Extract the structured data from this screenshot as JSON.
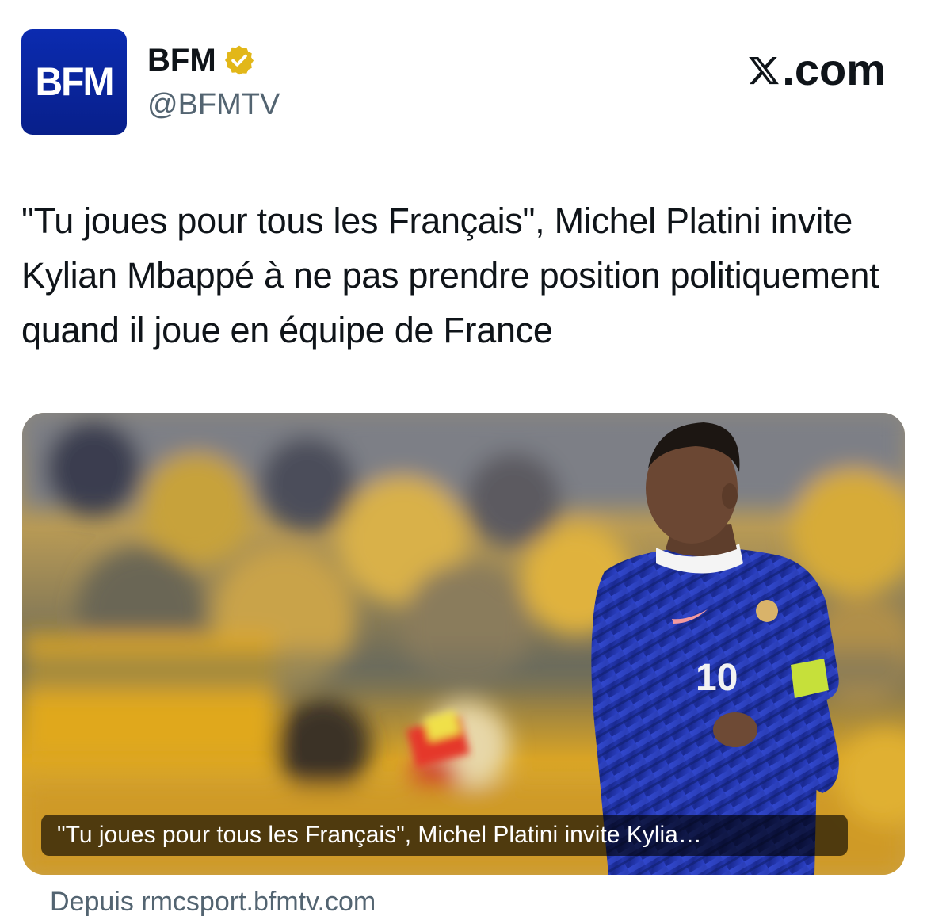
{
  "header": {
    "avatar_text": "BFM",
    "display_name": "BFM",
    "handle": "@BFMTV",
    "brand_text": ".com",
    "brand_icon": "x-logo-icon",
    "verified_icon": "verified-badge-icon",
    "verified_color": "#e2b719"
  },
  "post": {
    "headline": "\"Tu joues pour tous les Français\", Michel Platini invite Kylian Mbappé à ne pas prendre position politiquement quand il joue en équipe de France"
  },
  "card": {
    "image_icon": "article-photo",
    "caption": "\"Tu joues pour tous les Français\", Michel Platini invite Kylia…",
    "source": "Depuis rmcsport.bfmtv.com"
  },
  "colors": {
    "avatar_bg": "#0b2bb0",
    "text_primary": "#0f1419",
    "text_secondary": "#536471",
    "jersey_blue": "#1d2f9c"
  }
}
